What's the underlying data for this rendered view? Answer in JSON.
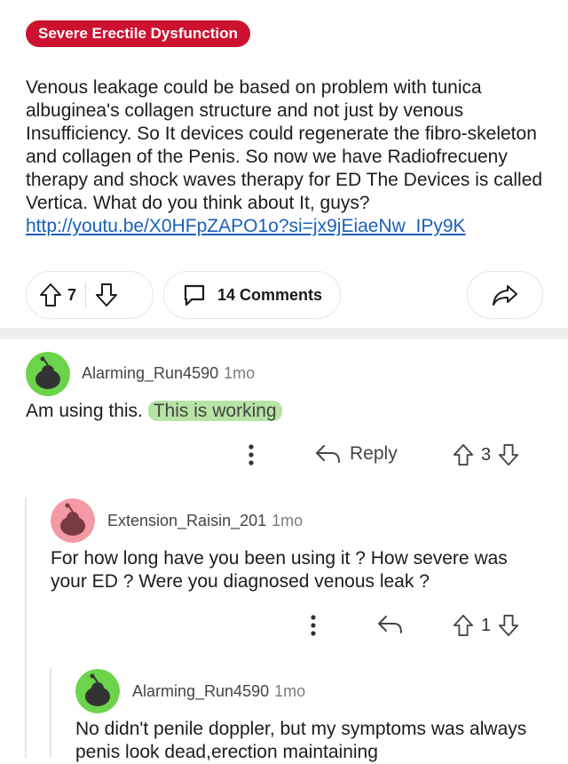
{
  "post": {
    "flair": "Severe Erectile Dysfunction",
    "body": "Venous leakage could be based on problem with tunica albuginea's collagen structure and not just by venous Insufficiency. So It devices could regenerate the fibro-skeleton and collagen of the Penis. So now we have Radiofrecueny therapy and shock waves therapy for ED The Devices is called Vertica. What do you think about It, guys? ",
    "link": "http://youtu.be/X0HFpZAPO1o?si=jx9jEiaeNw_IPy9K",
    "votes": "7",
    "comments_label": "14 Comments",
    "icons": {
      "upvote": "arrow-up-icon",
      "downvote": "arrow-down-icon",
      "comments": "speech-bubble-icon",
      "share": "share-arrow-icon"
    }
  },
  "comments": [
    {
      "username": "Alarming_Run4590",
      "age": "1mo",
      "text": "Am using this. ",
      "highlight": "This is working",
      "reply_label": "Reply",
      "votes": "3",
      "avatar_color": "#6bd44a"
    },
    {
      "username": "Extension_Raisin_201",
      "age": "1mo",
      "text": "For how long have you been using it ? How severe was your ED ? Were you diagnosed venous leak ?",
      "votes": "1",
      "avatar_color": "#f49aa6"
    },
    {
      "username": "Alarming_Run4590",
      "age": "1mo",
      "text": "No didn't penile doppler, but my symptoms  was always  penis  look dead,erection  maintaining",
      "avatar_color": "#6bd44a"
    }
  ],
  "colors": {
    "flair_bg": "#cc1230",
    "link": "#1a60b8",
    "highlight": "#b7e4a6"
  }
}
